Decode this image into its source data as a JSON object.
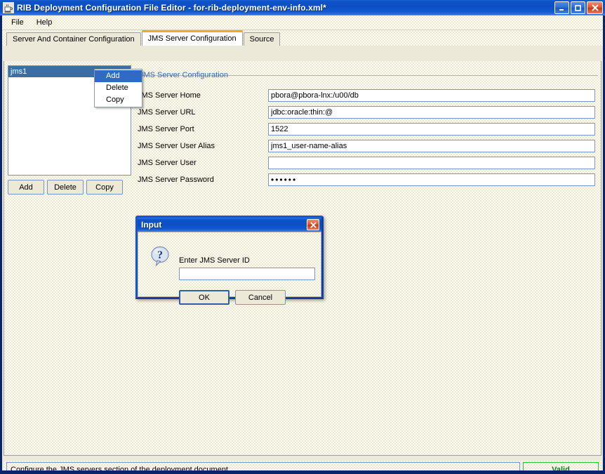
{
  "window": {
    "title": "RIB Deployment Configuration File Editor - for-rib-deployment-env-info.xml*",
    "icon": "java-coffee-cup-icon",
    "controls": {
      "minimize": "Minimize",
      "maximize": "Maximize",
      "close": "Close"
    }
  },
  "menubar": {
    "items": [
      {
        "label": "File"
      },
      {
        "label": "Help"
      }
    ]
  },
  "tabs": [
    {
      "label": "Server And Container Configuration",
      "selected": false
    },
    {
      "label": "JMS Server Configuration",
      "selected": true
    },
    {
      "label": "Source",
      "selected": false
    }
  ],
  "left_panel": {
    "list_items": [
      {
        "label": "jms1",
        "selected": true
      }
    ],
    "buttons": [
      {
        "label": "Add"
      },
      {
        "label": "Delete"
      },
      {
        "label": "Copy"
      }
    ]
  },
  "context_menu": {
    "items": [
      {
        "label": "Add",
        "highlighted": true
      },
      {
        "label": "Delete",
        "highlighted": false
      },
      {
        "label": "Copy",
        "highlighted": false
      }
    ]
  },
  "form": {
    "group_title": "JMS Server Configuration",
    "rows": [
      {
        "label": "JMS Server Home",
        "value": "pbora@pbora-lnx:/u00/db",
        "type": "text"
      },
      {
        "label": "JMS Server URL",
        "value": "jdbc:oracle:thin:@",
        "type": "text"
      },
      {
        "label": "JMS Server Port",
        "value": "1522",
        "type": "text"
      },
      {
        "label": "JMS Server User Alias",
        "value": "jms1_user-name-alias",
        "type": "text"
      },
      {
        "label": "JMS Server User",
        "value": "",
        "type": "text"
      },
      {
        "label": "JMS Server Password",
        "value": "••••••",
        "type": "password"
      }
    ]
  },
  "dialog": {
    "title": "Input",
    "icon": "question-bubble-icon",
    "prompt": "Enter JMS Server ID",
    "input_value": "",
    "buttons": [
      {
        "label": "OK",
        "default": true
      },
      {
        "label": "Cancel",
        "default": false
      }
    ],
    "close_label": "Close"
  },
  "statusbar": {
    "message": "Configure the JMS servers section of the deployment document.",
    "badge": "Valid"
  },
  "colors": {
    "titlebar_blue": "#0d4ec4",
    "accent_orange": "#f5a623",
    "selection_blue": "#316ac5",
    "valid_green": "#108010",
    "panel_beige": "#ece9d8",
    "group_title_blue": "#316ac5"
  }
}
